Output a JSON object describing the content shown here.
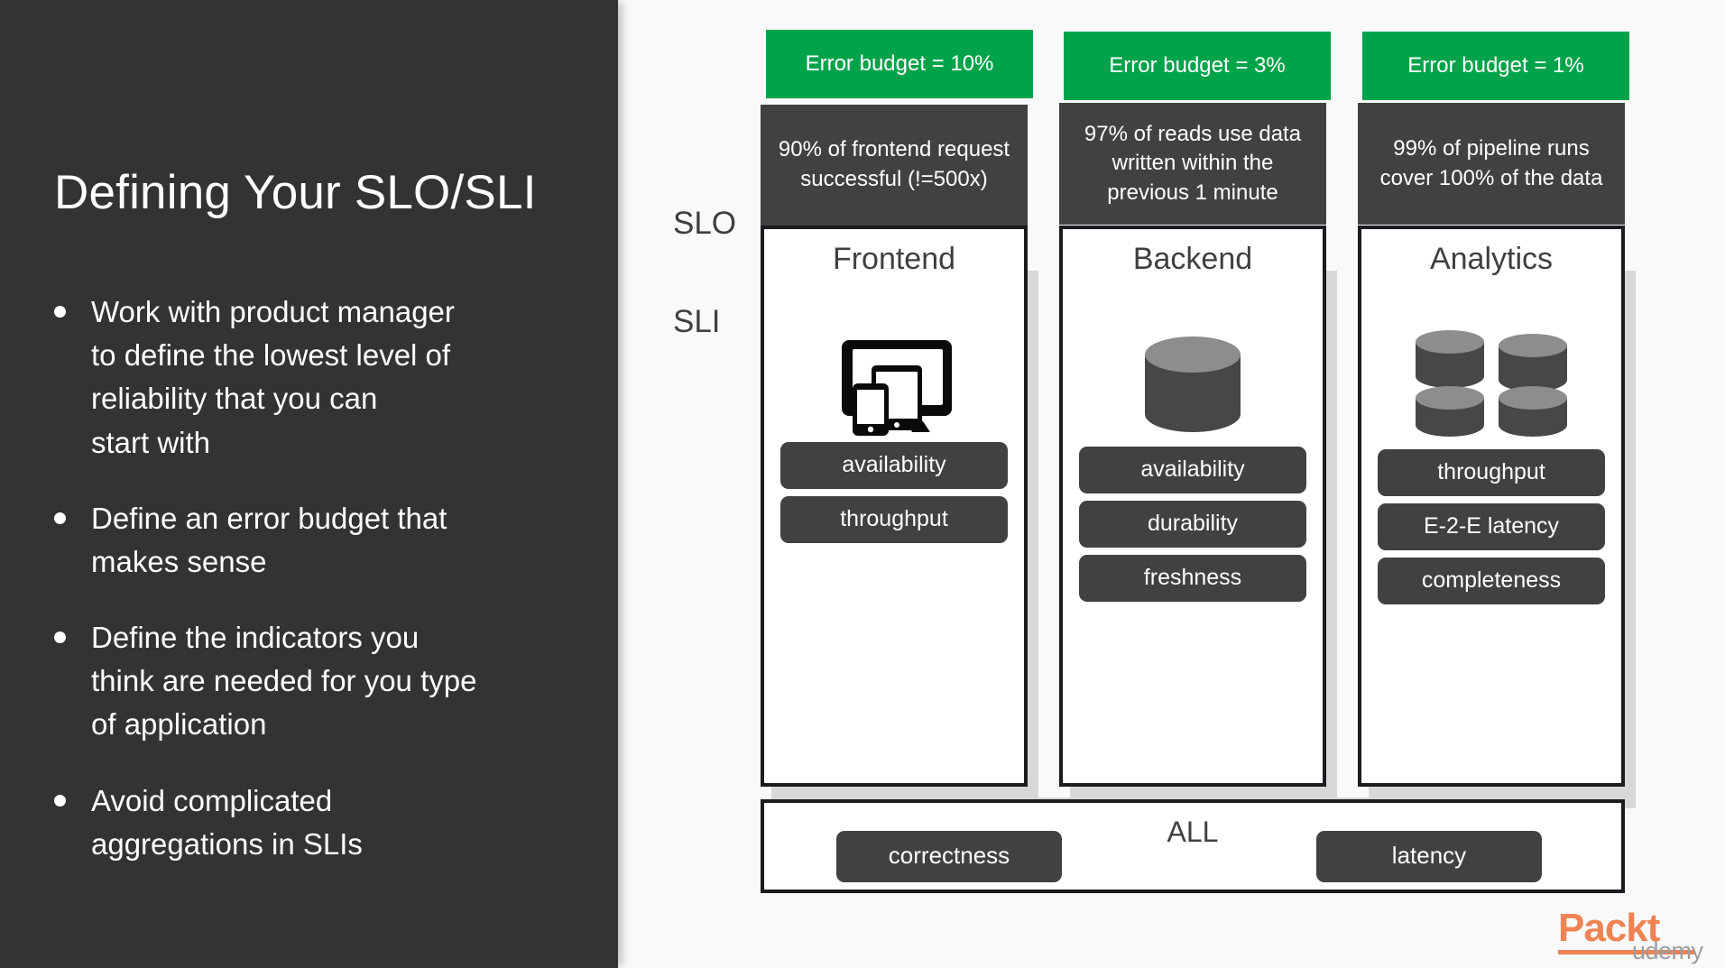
{
  "slide": {
    "title": "Defining Your SLO/SLI",
    "bullets": [
      "Work with product manager\nto define the lowest level of\nreliability that you can\nstart with",
      "Define an error budget that\nmakes sense",
      "Define the indicators you\nthink are needed for you type\nof application",
      "Avoid complicated\naggregations in SLIs"
    ]
  },
  "diagram": {
    "axis": {
      "slo": "SLO",
      "sli": "SLI"
    },
    "accent_green": "#00a34a",
    "dark_gray": "#414141",
    "columns": [
      {
        "budget": "Error budget = 10%",
        "slo": "90% of frontend request successful (!=500x)",
        "title": "Frontend",
        "icon": "devices-icon",
        "tags": [
          "availability",
          "throughput"
        ]
      },
      {
        "budget": "Error budget = 3%",
        "slo": "97% of reads use data written within the previous 1 minute",
        "title": "Backend",
        "icon": "database-icon",
        "tags": [
          "availability",
          "durability",
          "freshness"
        ]
      },
      {
        "budget": "Error budget = 1%",
        "slo": "99% of pipeline runs cover 100% of the data",
        "title": "Analytics",
        "icon": "database-cluster-icon",
        "tags": [
          "throughput",
          "E-2-E latency",
          "completeness"
        ]
      }
    ],
    "all_row": {
      "label": "ALL",
      "tags": [
        "correctness",
        "latency"
      ]
    }
  },
  "branding": {
    "logo_text": "Packt",
    "logo_sub": "udemy"
  }
}
